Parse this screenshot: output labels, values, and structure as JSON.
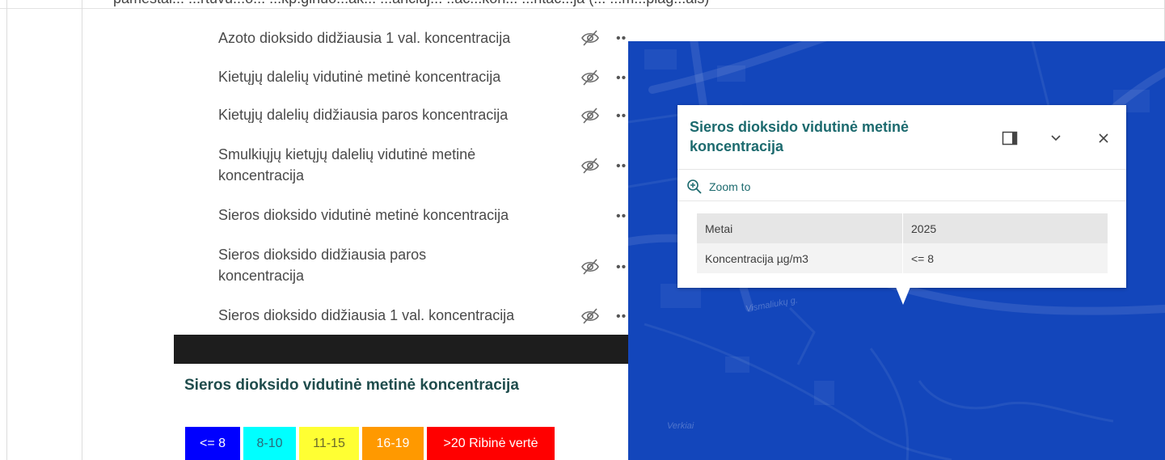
{
  "doc_header_fragment": "pamestai... ...rtuvu...o... ...kp.ginuo...ak... ...anciuj... ..ac...kon... ...ntac...ja (... ...m...plag...ais)",
  "layers": [
    {
      "label": "Azoto dioksido didžiausia 1 val. koncentracija",
      "visibility_icon": "eye-hidden-icon",
      "hidden": true
    },
    {
      "label": "Kietųjų dalelių vidutinė metinė koncentracija",
      "visibility_icon": "eye-hidden-icon",
      "hidden": true
    },
    {
      "label": "Kietųjų dalelių didžiausia paros koncentracija",
      "visibility_icon": "eye-hidden-icon",
      "hidden": true
    },
    {
      "label": "Smulkiųjų kietųjų dalelių vidutinė metinė koncentracija",
      "visibility_icon": "eye-hidden-icon",
      "hidden": true
    },
    {
      "label": "Sieros dioksido vidutinė metinė koncentracija",
      "visibility_icon": "",
      "hidden": false
    },
    {
      "label": "Sieros dioksido didžiausia paros koncentracija",
      "visibility_icon": "eye-hidden-icon",
      "hidden": true
    },
    {
      "label": "Sieros dioksido didžiausia 1 val. koncentracija",
      "visibility_icon": "eye-hidden-icon",
      "hidden": true
    }
  ],
  "legend": {
    "title": "Sieros dioksido vidutinė metinė koncentracija",
    "classes": [
      {
        "label": "<= 8",
        "color": "#0000ff",
        "text_color": "#ffffff"
      },
      {
        "label": "8-10",
        "color": "#00ffff",
        "text_color": "#2a6a7a"
      },
      {
        "label": "11-15",
        "color": "#ffff33",
        "text_color": "#6a6a2a"
      },
      {
        "label": "16-19",
        "color": "#ff9900",
        "text_color": "#ffffff"
      },
      {
        "label": ">20 Ribinė vertė",
        "color": "#ff0000",
        "text_color": "#ffffff"
      }
    ]
  },
  "map": {
    "background_color": "#1346bb",
    "street_labels": [
      "Vismaliukų g.",
      "Verkiai"
    ]
  },
  "popup": {
    "title": "Sieros dioksido vidutinė metinė koncentracija",
    "dock_icon": "dock-icon",
    "collapse_icon": "chevron-down-icon",
    "close_icon": "close-icon",
    "zoom_label": "Zoom to",
    "zoom_icon": "zoom-in-icon",
    "fields": [
      {
        "key": "Metai",
        "value": "2025"
      },
      {
        "key": "Koncentracija µg/m3",
        "value": "<= 8"
      }
    ]
  }
}
